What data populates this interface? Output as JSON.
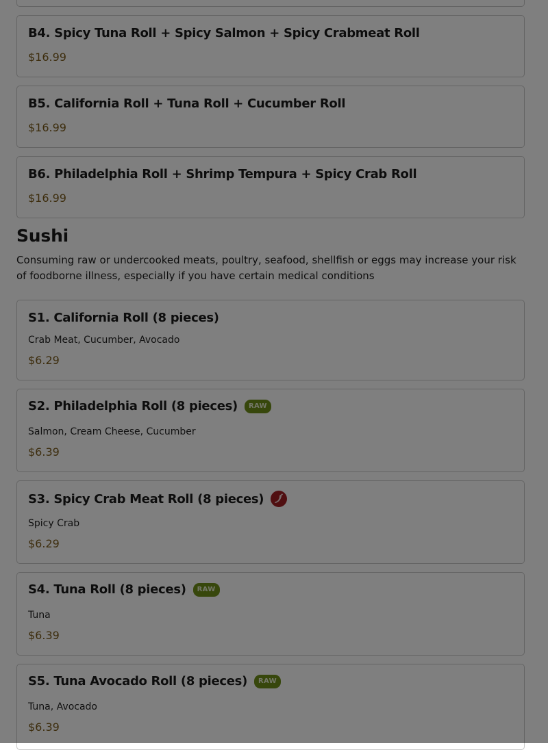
{
  "bundles": [
    {
      "title": "B4. Spicy Tuna Roll + Spicy Salmon + Spicy Crabmeat Roll",
      "price": "$16.99"
    },
    {
      "title": "B5. California Roll + Tuna Roll + Cucumber Roll",
      "price": "$16.99"
    },
    {
      "title": "B6. Philadelphia Roll + Shrimp Tempura + Spicy Crab Roll",
      "price": "$16.99"
    }
  ],
  "sushi": {
    "heading": "Sushi",
    "note": "Consuming raw or undercooked meats, poultry, seafood, shellfish or eggs may increase your risk of foodborne illness, especially if you have certain medical conditions",
    "items": [
      {
        "title": "S1. California Roll (8 pieces)",
        "description": "Crab Meat, Cucumber, Avocado",
        "price": "$6.29"
      },
      {
        "title": "S2. Philadelphia Roll (8 pieces)",
        "badge": "RAW",
        "description": "Salmon, Cream Cheese, Cucumber",
        "price": "$6.39"
      },
      {
        "title": "S3. Spicy Crab Meat Roll (8 pieces)",
        "icon": "chili-pepper-icon",
        "description": "Spicy Crab",
        "price": "$6.29"
      },
      {
        "title": "S4. Tuna Roll (8 pieces)",
        "badge": "RAW",
        "description": "Tuna",
        "price": "$6.39"
      },
      {
        "title": "S5. Tuna Avocado Roll (8 pieces)",
        "badge": "RAW",
        "description": "Tuna, Avocado",
        "price": "$6.39"
      }
    ]
  },
  "colors": {
    "price": "#7a5a1a",
    "raw_badge": "#6f8e18",
    "spicy_icon": "#a01e22",
    "overlay": "rgba(0,0,0,0.5)"
  }
}
